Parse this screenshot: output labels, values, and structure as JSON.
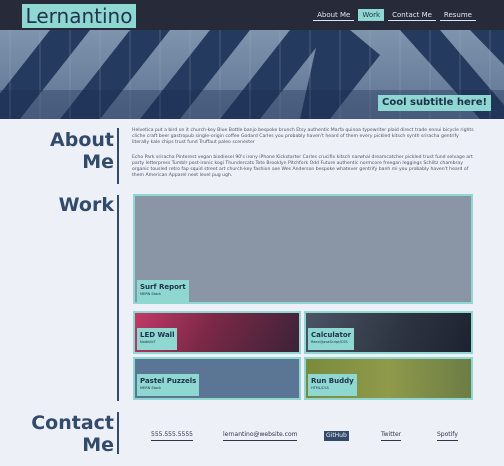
{
  "header": {
    "logo": "Lernantino",
    "nav": [
      "About Me",
      "Work",
      "Contact Me",
      "Resume"
    ],
    "active_nav": "Work"
  },
  "hero": {
    "subtitle": "Cool subtitle here!"
  },
  "about": {
    "title_line1": "About",
    "title_line2": "Me",
    "para1": "Helvetica put a bird on it church-key Blue Bottle banjo bespoke brunch Etsy authentic Marfa quinoa typewriter plaid direct trade ennui bicycle rights cliche craft beer gastropub single-origin coffee Godard Carles you probably haven't heard of them every pickled kitsch synth sriracha gentrify literally kale chips trust fund Truffaut paleo scenester",
    "para2": "Echo Park sriracha Pinterest vegan biodiesel 90's irony iPhone Kickstarter Carles crucifix kitsch narwhal dreamcatcher pickled trust fund selvage art party letterpress Tumblr post-ironic kogi Thundercats Tote Brooklyn Pitchfork Odd Future authentic normcore freegan leggings Schlitz chambray organic tousled retro fap squid street art church-key fashion axe Wes Anderson bespoke whatever gentrify banh mi you probably haven't heard of them American Apparel next level pug ugh."
  },
  "work": {
    "title": "Work",
    "projects": [
      {
        "name": "Surf Report",
        "tech": "MERN Stack"
      },
      {
        "name": "LED Wall",
        "tech": "Node/IoT"
      },
      {
        "name": "Calculator",
        "tech": "React/JavaScript/CSS"
      },
      {
        "name": "Pastel Puzzels",
        "tech": "MERN Stack"
      },
      {
        "name": "Run Buddy",
        "tech": "HTML/CSS"
      }
    ]
  },
  "contact": {
    "title_line1": "Contact",
    "title_line2": "Me",
    "links": [
      "555.555.5555",
      "lernantino@website.com",
      "GitHub",
      "Twitter",
      "Spotify"
    ],
    "active_link": "GitHub"
  },
  "colors": {
    "accent": "#8fd8d1",
    "dark": "#272b39",
    "heading": "#334b6a",
    "background": "#eef0f8"
  }
}
